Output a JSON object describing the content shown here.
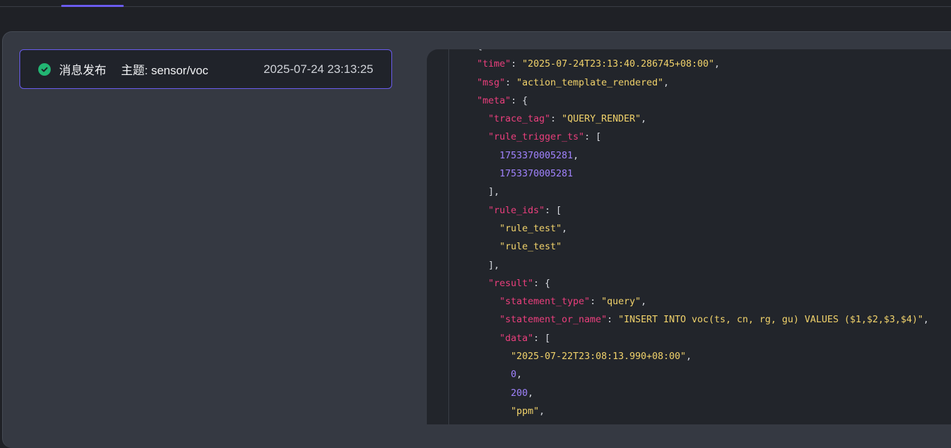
{
  "event": {
    "title": "消息发布",
    "topic": "主题: sensor/voc",
    "timestamp": "2025-07-24 23:13:25",
    "status_icon": "check-circle-icon",
    "status_color": "#22b573",
    "accent": "#6b5cf0"
  },
  "code_lines": [
    [
      {
        "t": "p",
        "v": "{"
      }
    ],
    [
      {
        "t": "k",
        "v": "\"time\""
      },
      {
        "t": "p",
        "v": ": "
      },
      {
        "t": "s",
        "v": "\"2025-07-24T23:13:40.286745+08:00\""
      },
      {
        "t": "p",
        "v": ","
      }
    ],
    [
      {
        "t": "k",
        "v": "\"msg\""
      },
      {
        "t": "p",
        "v": ": "
      },
      {
        "t": "s",
        "v": "\"action_template_rendered\""
      },
      {
        "t": "p",
        "v": ","
      }
    ],
    [
      {
        "t": "k",
        "v": "\"meta\""
      },
      {
        "t": "p",
        "v": ": {"
      }
    ],
    [
      {
        "t": "p",
        "v": "  "
      },
      {
        "t": "k",
        "v": "\"trace_tag\""
      },
      {
        "t": "p",
        "v": ": "
      },
      {
        "t": "s",
        "v": "\"QUERY_RENDER\""
      },
      {
        "t": "p",
        "v": ","
      }
    ],
    [
      {
        "t": "p",
        "v": "  "
      },
      {
        "t": "k",
        "v": "\"rule_trigger_ts\""
      },
      {
        "t": "p",
        "v": ": ["
      }
    ],
    [
      {
        "t": "p",
        "v": "    "
      },
      {
        "t": "n",
        "v": "1753370005281"
      },
      {
        "t": "p",
        "v": ","
      }
    ],
    [
      {
        "t": "p",
        "v": "    "
      },
      {
        "t": "n",
        "v": "1753370005281"
      }
    ],
    [
      {
        "t": "p",
        "v": "  ],"
      }
    ],
    [
      {
        "t": "p",
        "v": "  "
      },
      {
        "t": "k",
        "v": "\"rule_ids\""
      },
      {
        "t": "p",
        "v": ": ["
      }
    ],
    [
      {
        "t": "p",
        "v": "    "
      },
      {
        "t": "s",
        "v": "\"rule_test\""
      },
      {
        "t": "p",
        "v": ","
      }
    ],
    [
      {
        "t": "p",
        "v": "    "
      },
      {
        "t": "s",
        "v": "\"rule_test\""
      }
    ],
    [
      {
        "t": "p",
        "v": "  ],"
      }
    ],
    [
      {
        "t": "p",
        "v": "  "
      },
      {
        "t": "k",
        "v": "\"result\""
      },
      {
        "t": "p",
        "v": ": {"
      }
    ],
    [
      {
        "t": "p",
        "v": "    "
      },
      {
        "t": "k",
        "v": "\"statement_type\""
      },
      {
        "t": "p",
        "v": ": "
      },
      {
        "t": "s",
        "v": "\"query\""
      },
      {
        "t": "p",
        "v": ","
      }
    ],
    [
      {
        "t": "p",
        "v": "    "
      },
      {
        "t": "k",
        "v": "\"statement_or_name\""
      },
      {
        "t": "p",
        "v": ": "
      },
      {
        "t": "s",
        "v": "\"INSERT INTO voc(ts, cn, rg, gu) VALUES ($1,$2,$3,$4)\""
      },
      {
        "t": "p",
        "v": ","
      }
    ],
    [
      {
        "t": "p",
        "v": "    "
      },
      {
        "t": "k",
        "v": "\"data\""
      },
      {
        "t": "p",
        "v": ": ["
      }
    ],
    [
      {
        "t": "p",
        "v": "      "
      },
      {
        "t": "s",
        "v": "\"2025-07-22T23:08:13.990+08:00\""
      },
      {
        "t": "p",
        "v": ","
      }
    ],
    [
      {
        "t": "p",
        "v": "      "
      },
      {
        "t": "n",
        "v": "0"
      },
      {
        "t": "p",
        "v": ","
      }
    ],
    [
      {
        "t": "p",
        "v": "      "
      },
      {
        "t": "n",
        "v": "200"
      },
      {
        "t": "p",
        "v": ","
      }
    ],
    [
      {
        "t": "p",
        "v": "      "
      },
      {
        "t": "s",
        "v": "\"ppm\""
      },
      {
        "t": "p",
        "v": ","
      }
    ]
  ]
}
